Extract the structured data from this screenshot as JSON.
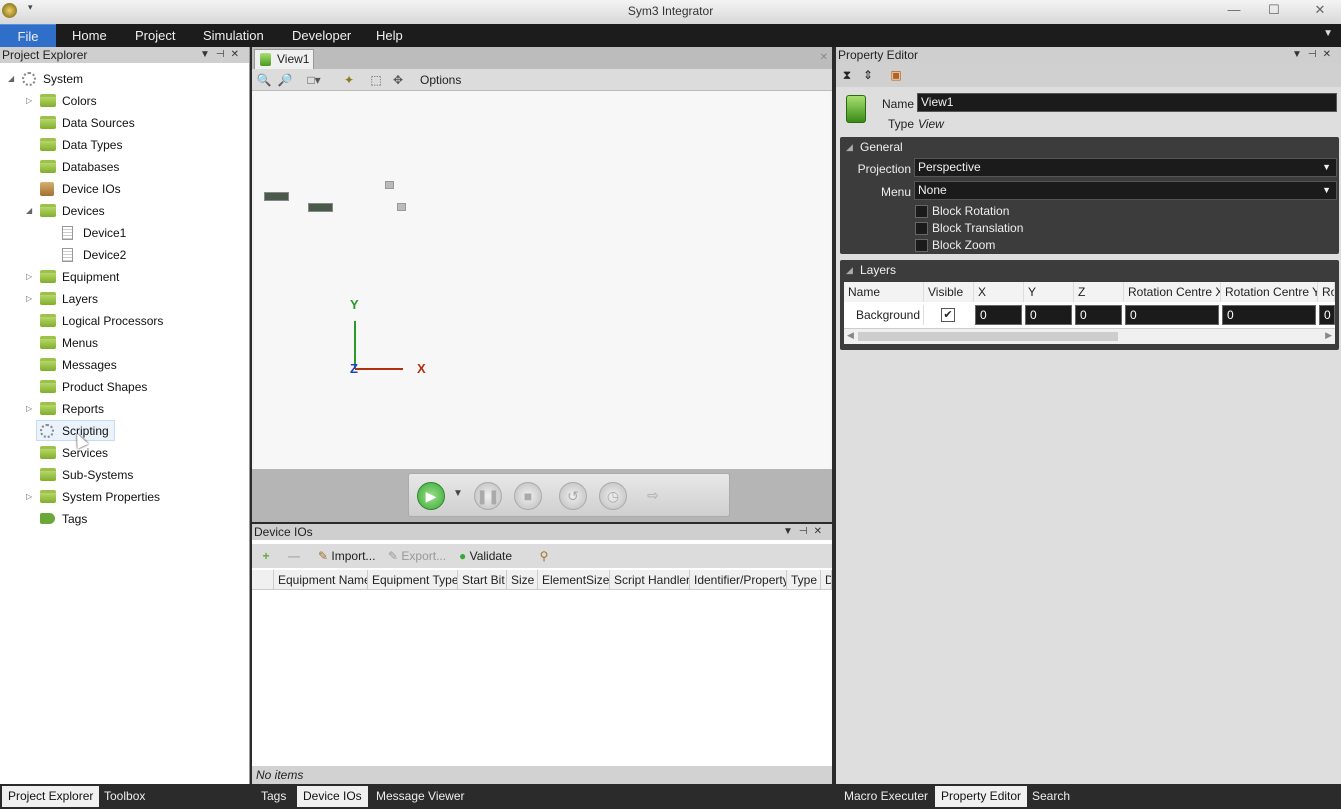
{
  "window": {
    "title": "Sym3 Integrator"
  },
  "menu": {
    "file": "File",
    "home": "Home",
    "project": "Project",
    "simulation": "Simulation",
    "developer": "Developer",
    "help": "Help"
  },
  "explorer": {
    "title": "Project Explorer",
    "items": [
      {
        "label": "System",
        "icon": "gear-icon"
      },
      {
        "label": "Colors",
        "icon": "folder-icon"
      },
      {
        "label": "Data Sources",
        "icon": "folder-icon"
      },
      {
        "label": "Data Types",
        "icon": "folder-icon"
      },
      {
        "label": "Databases",
        "icon": "folder-icon"
      },
      {
        "label": "Device IOs",
        "icon": "device-io-icon"
      },
      {
        "label": "Devices",
        "icon": "folder-icon"
      },
      {
        "label": "Device1",
        "icon": "device-icon"
      },
      {
        "label": "Device2",
        "icon": "device-icon"
      },
      {
        "label": "Equipment",
        "icon": "folder-icon"
      },
      {
        "label": "Layers",
        "icon": "folder-icon"
      },
      {
        "label": "Logical Processors",
        "icon": "folder-icon"
      },
      {
        "label": "Menus",
        "icon": "folder-icon"
      },
      {
        "label": "Messages",
        "icon": "folder-icon"
      },
      {
        "label": "Product Shapes",
        "icon": "folder-icon"
      },
      {
        "label": "Reports",
        "icon": "folder-icon"
      },
      {
        "label": "Scripting",
        "icon": "gear-icon"
      },
      {
        "label": "Services",
        "icon": "folder-icon"
      },
      {
        "label": "Sub-Systems",
        "icon": "folder-icon"
      },
      {
        "label": "System Properties",
        "icon": "folder-icon"
      },
      {
        "label": "Tags",
        "icon": "tag-icon"
      }
    ]
  },
  "view": {
    "tab": "View1",
    "options": "Options",
    "axis_x": "X",
    "axis_y": "Y",
    "axis_z": "Z"
  },
  "deviceios": {
    "title": "Device IOs",
    "import": "Import...",
    "export": "Export...",
    "validate": "Validate",
    "columns": [
      "Equipment Name",
      "Equipment Type",
      "Start Bit",
      "Size",
      "ElementSize",
      "Script Handler",
      "Identifier/Property",
      "Type",
      "D"
    ],
    "status": "No items"
  },
  "props": {
    "title": "Property Editor",
    "name_label": "Name",
    "name_value": "View1",
    "type_label": "Type",
    "type_value": "View",
    "general": "General",
    "projection_label": "Projection",
    "projection_value": "Perspective",
    "menu_label": "Menu",
    "menu_value": "None",
    "block_rotation": "Block Rotation",
    "block_translation": "Block Translation",
    "block_zoom": "Block Zoom",
    "layers": "Layers",
    "layer_cols": [
      "Name",
      "Visible",
      "X",
      "Y",
      "Z",
      "Rotation Centre X",
      "Rotation Centre Y",
      "Ro"
    ],
    "layer_row": {
      "name": "Background",
      "visible": "✔",
      "x": "0",
      "y": "0",
      "z": "0",
      "rcx": "0",
      "rcy": "0",
      "r": "0"
    }
  },
  "bottom_tabs": {
    "left": [
      "Project Explorer",
      "Toolbox"
    ],
    "middle": [
      "Tags",
      "Device IOs",
      "Message Viewer"
    ],
    "right": [
      "Macro Executer",
      "Property Editor",
      "Search"
    ]
  },
  "colors": {
    "accent": "#2f6fc9",
    "folder": "#8fbf3a",
    "play": "#3aa838",
    "axis_x": "#b03010",
    "axis_y": "#2a9a2a",
    "axis_z": "#2040c0"
  }
}
